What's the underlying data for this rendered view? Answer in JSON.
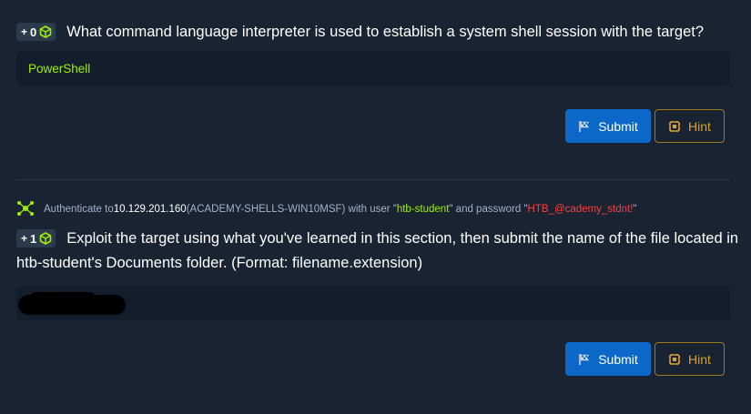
{
  "question1": {
    "points": "0",
    "plus": "+",
    "text": "What command language interpreter is used to establish a system shell session with the target?",
    "answer": "PowerShell",
    "submit_label": "Submit",
    "hint_label": "Hint"
  },
  "auth": {
    "prefix": "Authenticate to ",
    "ip": "10.129.201.160",
    "host": " (ACADEMY-SHELLS-WIN10MSF) with user \"",
    "user": "htb-student",
    "mid": "\" and password \"",
    "password": "HTB_@cademy_stdnt!",
    "suffix": "\""
  },
  "question2": {
    "points": "1",
    "plus": "+",
    "text_line1": "Exploit the target using what you've learned in this section, then submit the name of the file located in",
    "text_line2": "htb-student's Documents folder. (Format: filename.extension)",
    "answer": "",
    "submit_label": "Submit",
    "hint_label": "Hint"
  },
  "colors": {
    "background": "#1a2332",
    "input_background": "#141d2b",
    "accent_green": "#9fef00",
    "submit_blue": "#0b68c9",
    "hint_gold": "#d7a12c",
    "password_red": "#ff3e3e"
  },
  "icons": {
    "badge": "cube-icon",
    "submit": "flag-icon",
    "hint": "hint-icon",
    "target": "network-icon"
  }
}
